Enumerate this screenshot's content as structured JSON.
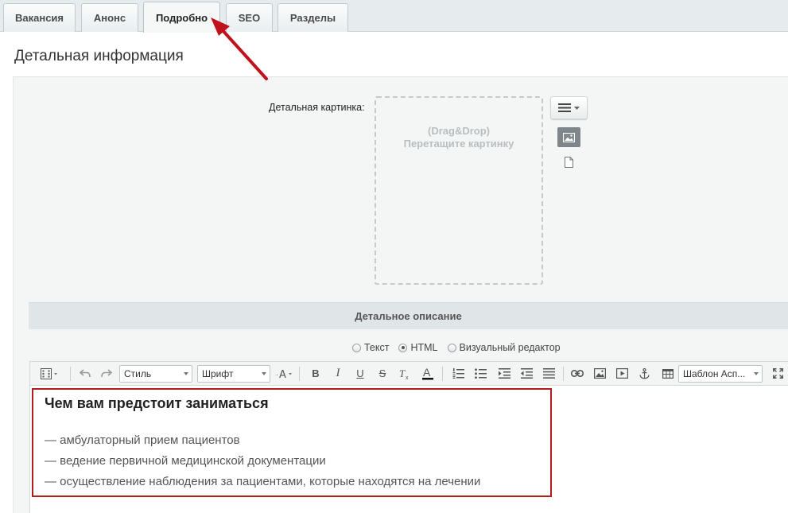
{
  "tabs": [
    {
      "label": "Вакансия"
    },
    {
      "label": "Анонс"
    },
    {
      "label": "Подробно",
      "active": true
    },
    {
      "label": "SEO"
    },
    {
      "label": "Разделы"
    }
  ],
  "section": {
    "title": "Детальная информация"
  },
  "image_field": {
    "label": "Детальная картинка:",
    "drop_line1": "(Drag&Drop)",
    "drop_line2": "Перетащите картинку"
  },
  "description": {
    "header": "Детальное описание",
    "modes": [
      {
        "label": "Текст",
        "selected": false
      },
      {
        "label": "HTML",
        "selected": true
      },
      {
        "label": "Визуальный редактор",
        "selected": false
      }
    ]
  },
  "toolbar": {
    "style_select": "Стиль",
    "font_select": "Шрифт",
    "template_select": "Шаблон Асп..."
  },
  "content": {
    "heading": "Чем вам предстоит заниматься",
    "lines": [
      "— амбулаторный прием пациентов",
      "— ведение первичной медицинской документации",
      "— осуществление наблюдения за пациентами, которые находятся на лечении"
    ]
  },
  "colors": {
    "highlight_border": "#b11d1d",
    "annotation_arrow": "#c0121d"
  }
}
